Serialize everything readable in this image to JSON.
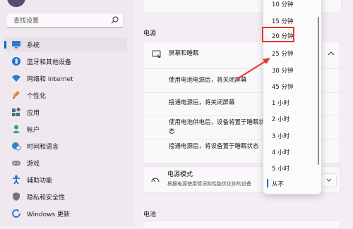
{
  "search": {
    "placeholder": "查找设置"
  },
  "sidebar": {
    "items": [
      {
        "label": "系统",
        "icon": "monitor-icon",
        "selected": true
      },
      {
        "label": "蓝牙和其他设备",
        "icon": "bluetooth-icon"
      },
      {
        "label": "网络和 Internet",
        "icon": "wifi-icon"
      },
      {
        "label": "个性化",
        "icon": "brush-icon"
      },
      {
        "label": "应用",
        "icon": "apps-icon"
      },
      {
        "label": "帐户",
        "icon": "person-icon"
      },
      {
        "label": "时间和语言",
        "icon": "globe-clock-icon"
      },
      {
        "label": "游戏",
        "icon": "gamepad-icon"
      },
      {
        "label": "辅助功能",
        "icon": "accessibility-icon"
      },
      {
        "label": "隐私和安全性",
        "icon": "shield-icon"
      },
      {
        "label": "Windows 更新",
        "icon": "windows-update-icon"
      }
    ]
  },
  "main": {
    "power_section_title": "电源",
    "screen_sleep": {
      "title": "屏幕和睡眠",
      "rows": [
        {
          "label": "使用电池电源后，将关闭屏幕"
        },
        {
          "label": "接通电源后，将关闭屏幕"
        },
        {
          "label": "使用电池供电后，设备将置于睡眠状态"
        },
        {
          "label": "接通电源后，将设备置于睡眠状态"
        }
      ]
    },
    "power_mode": {
      "title": "电源模式",
      "description": "根据电源使用情况和性能优化你的设备"
    },
    "battery_section_title": "电池"
  },
  "dropdown": {
    "options": [
      "10 分钟",
      "15 分钟",
      "20 分钟",
      "25 分钟",
      "30 分钟",
      "45 分钟",
      "1 小时",
      "2 小时",
      "3 小时",
      "4 小时",
      "5 小时",
      "从不"
    ],
    "highlighted": "20 分钟",
    "selected": "从不"
  },
  "colors": {
    "accent": "#0067c0",
    "annotation_red": "#e5342a"
  }
}
